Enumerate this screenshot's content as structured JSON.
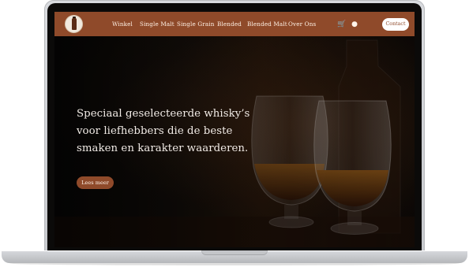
{
  "nav": {
    "items": [
      {
        "label": "Winkel"
      },
      {
        "label": "Single Malt"
      },
      {
        "label": "Single Grain"
      },
      {
        "label": "Blended"
      },
      {
        "label": "Blended Malt"
      },
      {
        "label": "Over Ons"
      }
    ],
    "contact_label": "Contact"
  },
  "icons": {
    "cart": "cart-icon",
    "user": "user-icon",
    "logo": "whisky-bottle-logo"
  },
  "hero": {
    "heading": "Speciaal geselecteerde whisky’s voor liefhebbers die de beste smaken en karakter waarderen.",
    "cta_label": "Lees meer"
  },
  "colors": {
    "brand": "#8f4a2a",
    "hero_text": "#f1ebe6",
    "background": "#080706"
  }
}
